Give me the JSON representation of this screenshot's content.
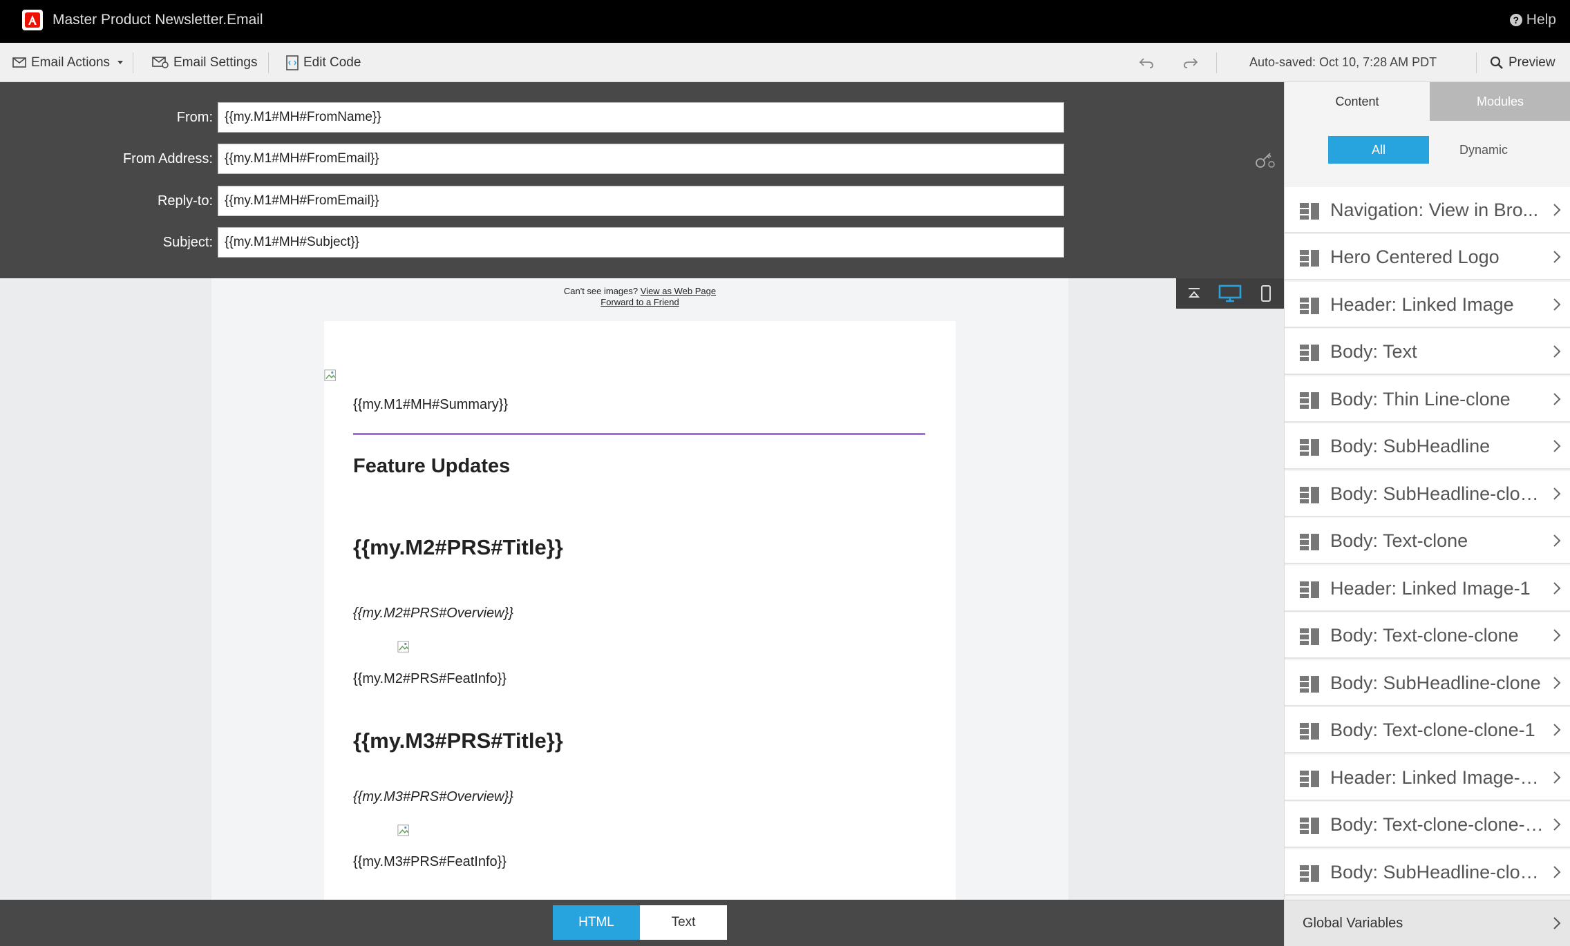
{
  "app": {
    "title": "Master Product Newsletter.Email",
    "help_label": "Help"
  },
  "toolbar": {
    "email_actions": "Email Actions",
    "email_settings": "Email Settings",
    "edit_code": "Edit Code",
    "autosave": "Auto-saved: Oct 10, 7:28 AM PDT",
    "preview": "Preview"
  },
  "fields": {
    "from_label": "From:",
    "from_value": "{{my.M1#MH#FromName}}",
    "from_address_label": "From Address:",
    "from_address_value": "{{my.M1#MH#FromEmail}}",
    "reply_to_label": "Reply-to:",
    "reply_to_value": "{{my.M1#MH#FromEmail}}",
    "subject_label": "Subject:",
    "subject_value": "{{my.M1#MH#Subject}}"
  },
  "email": {
    "preheader_text": "Can't see images?",
    "view_web_link": "View as Web Page",
    "forward_link": "Forward to a Friend",
    "summary": "{{my.M1#MH#Summary}}",
    "feature_updates": "Feature Updates",
    "m2_title": "{{my.M2#PRS#Title}}",
    "m2_overview": "{{my.M2#PRS#Overview}}",
    "m2_featinfo": "{{my.M2#PRS#FeatInfo}}",
    "m3_title": "{{my.M3#PRS#Title}}",
    "m3_overview": "{{my.M3#PRS#Overview}}",
    "m3_featinfo": "{{my.M3#PRS#FeatInfo}}"
  },
  "bottom": {
    "html_tab": "HTML",
    "text_tab": "Text",
    "selected": "HTML"
  },
  "sidebar": {
    "tab_content": "Content",
    "tab_modules": "Modules",
    "sub_all": "All",
    "sub_dynamic": "Dynamic",
    "items": [
      {
        "label": "Navigation: View in Bro..."
      },
      {
        "label": "Hero Centered Logo"
      },
      {
        "label": "Header: Linked Image"
      },
      {
        "label": "Body: Text"
      },
      {
        "label": "Body: Thin Line-clone"
      },
      {
        "label": "Body: SubHeadline"
      },
      {
        "label": "Body: SubHeadline-clon..."
      },
      {
        "label": "Body: Text-clone"
      },
      {
        "label": "Header: Linked Image-1"
      },
      {
        "label": "Body: Text-clone-clone"
      },
      {
        "label": "Body: SubHeadline-clone"
      },
      {
        "label": "Body: Text-clone-clone-1"
      },
      {
        "label": "Header: Linked Image-1..."
      },
      {
        "label": "Body: Text-clone-clone-c..."
      },
      {
        "label": "Body: SubHeadline-clon..."
      }
    ],
    "global_variables": "Global Variables"
  },
  "colors": {
    "accent_blue": "#27a3dd",
    "divider_purple": "#a66cd9",
    "header_dark": "#484848",
    "adobe_red": "#eb1000"
  }
}
